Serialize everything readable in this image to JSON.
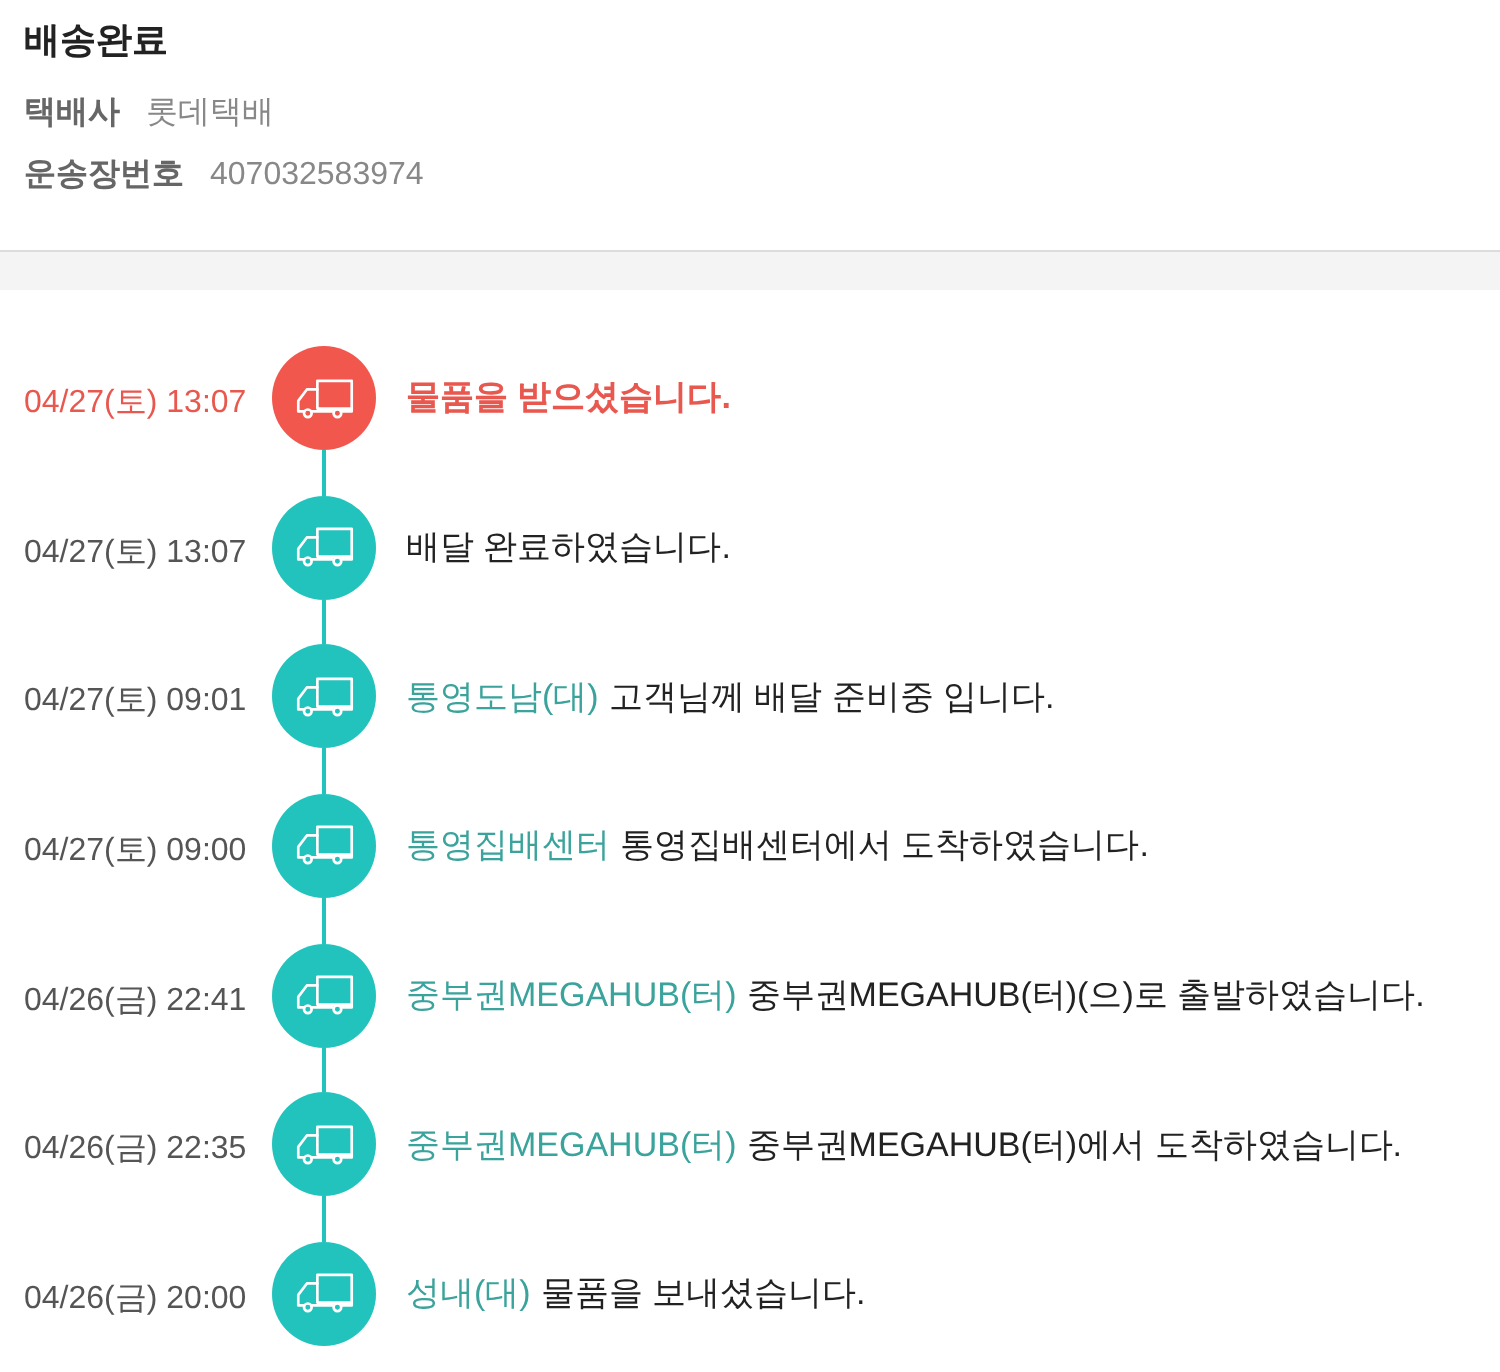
{
  "header": {
    "title": "배송완료",
    "fields": [
      {
        "label": "택배사",
        "value": "롯데택배"
      },
      {
        "label": "운송장번호",
        "value": "407032583974"
      }
    ]
  },
  "events": [
    {
      "time": "04/27(토) 13:07",
      "current": true,
      "message": "물품을 받으셨습니다."
    },
    {
      "time": "04/27(토) 13:07",
      "current": false,
      "message": "배달 완료하였습니다."
    },
    {
      "time": "04/27(토) 09:01",
      "current": false,
      "location": "통영도남(대)",
      "message": "고객님께 배달 준비중 입니다."
    },
    {
      "time": "04/27(토) 09:00",
      "current": false,
      "location": "통영집배센터",
      "message": "통영집배센터에서 도착하였습니다."
    },
    {
      "time": "04/26(금) 22:41",
      "current": false,
      "location": "중부권MEGAHUB(터)",
      "message": "중부권MEGAHUB(터)(으)로 출발하였습니다."
    },
    {
      "time": "04/26(금) 22:35",
      "current": false,
      "location": "중부권MEGAHUB(터)",
      "message": "중부권MEGAHUB(터)에서 도착하였습니다."
    },
    {
      "time": "04/26(금) 20:00",
      "current": false,
      "location": "성내(대)",
      "message": "물품을 보내셨습니다."
    }
  ]
}
